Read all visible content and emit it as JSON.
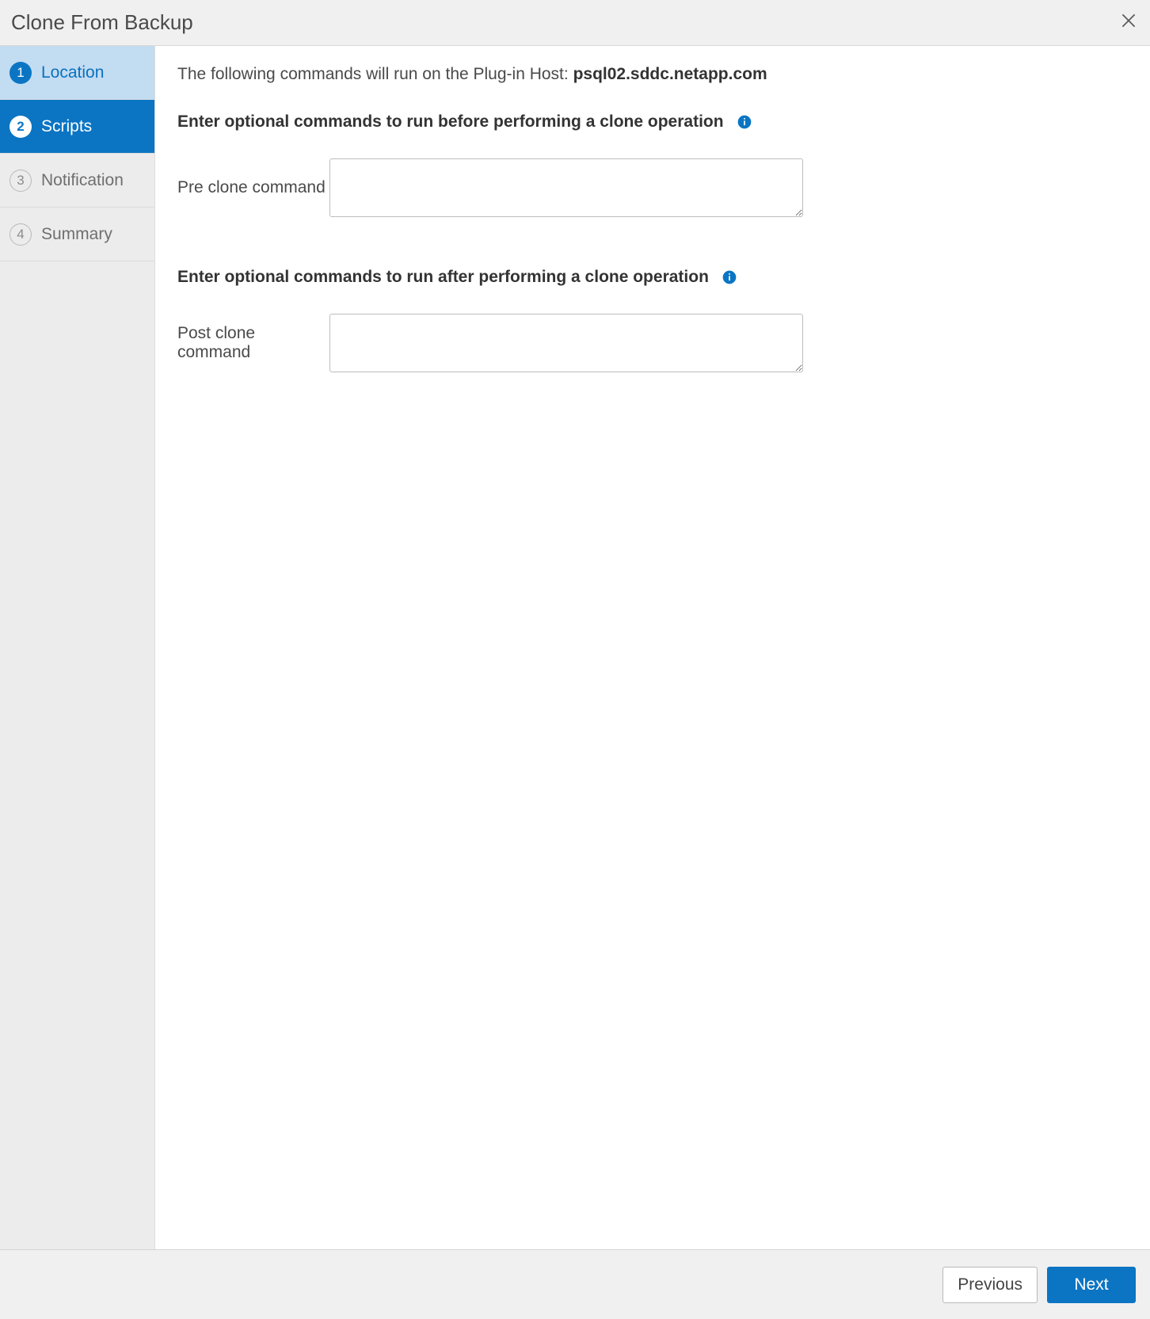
{
  "dialog": {
    "title": "Clone From Backup"
  },
  "steps": [
    {
      "num": "1",
      "label": "Location",
      "state": "completed"
    },
    {
      "num": "2",
      "label": "Scripts",
      "state": "active"
    },
    {
      "num": "3",
      "label": "Notification",
      "state": "pending"
    },
    {
      "num": "4",
      "label": "Summary",
      "state": "pending"
    }
  ],
  "content": {
    "hostLinePrefix": "The following commands will run on the Plug-in Host: ",
    "hostName": "psql02.sddc.netapp.com",
    "preHeading": "Enter optional commands to run before performing a clone operation",
    "preLabel": "Pre clone command",
    "preValue": "",
    "postHeading": "Enter optional commands to run after performing a clone operation",
    "postLabel": "Post clone command",
    "postValue": ""
  },
  "footer": {
    "previous": "Previous",
    "next": "Next"
  }
}
